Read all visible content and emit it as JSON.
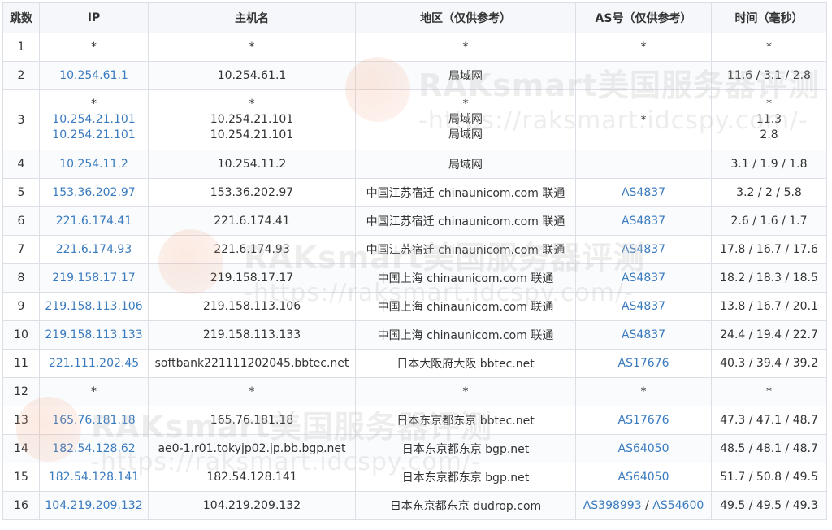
{
  "headers": {
    "hop": "跳数",
    "ip": "IP",
    "host": "主机名",
    "region": "地区（仅供参考）",
    "as": "AS号（仅供参考）",
    "time": "时间（毫秒）"
  },
  "watermark": {
    "title": "RAKsmart美国服务器评测",
    "url": "-https://raksmart.idcspy.com/-"
  },
  "colors": {
    "link": "#3a7bbf",
    "header_bg": "#f5f7fa",
    "border": "#dcdfe6"
  },
  "rows": [
    {
      "hop": "1",
      "ip": [
        "*"
      ],
      "host": [
        "*"
      ],
      "region": [
        "*"
      ],
      "as": [
        "*"
      ],
      "time": [
        "*"
      ]
    },
    {
      "hop": "2",
      "ip": [
        "10.254.61.1"
      ],
      "host": [
        "10.254.61.1"
      ],
      "region": [
        "局域网"
      ],
      "as": [],
      "time": [
        "11.6 / 3.1 / 2.8"
      ]
    },
    {
      "hop": "3",
      "ip": [
        "*",
        "10.254.21.101",
        "10.254.21.101"
      ],
      "host": [
        "*",
        "10.254.21.101",
        "10.254.21.101"
      ],
      "region": [
        "*",
        "局域网",
        "局域网"
      ],
      "as": [
        "*"
      ],
      "time": [
        "*",
        "11.3",
        "2.8"
      ]
    },
    {
      "hop": "4",
      "ip": [
        "10.254.11.2"
      ],
      "host": [
        "10.254.11.2"
      ],
      "region": [
        "局域网"
      ],
      "as": [],
      "time": [
        "3.1 / 1.9 / 1.8"
      ]
    },
    {
      "hop": "5",
      "ip": [
        "153.36.202.97"
      ],
      "host": [
        "153.36.202.97"
      ],
      "region": [
        "中国江苏宿迁 chinaunicom.com 联通"
      ],
      "as": [
        "AS4837"
      ],
      "time": [
        "3.2 / 2 / 5.8"
      ]
    },
    {
      "hop": "6",
      "ip": [
        "221.6.174.41"
      ],
      "host": [
        "221.6.174.41"
      ],
      "region": [
        "中国江苏宿迁 chinaunicom.com 联通"
      ],
      "as": [
        "AS4837"
      ],
      "time": [
        "2.6 / 1.6 / 1.7"
      ]
    },
    {
      "hop": "7",
      "ip": [
        "221.6.174.93"
      ],
      "host": [
        "221.6.174.93"
      ],
      "region": [
        "中国江苏宿迁 chinaunicom.com 联通"
      ],
      "as": [
        "AS4837"
      ],
      "time": [
        "17.8 / 16.7 / 17.6"
      ]
    },
    {
      "hop": "8",
      "ip": [
        "219.158.17.17"
      ],
      "host": [
        "219.158.17.17"
      ],
      "region": [
        "中国上海 chinaunicom.com 联通"
      ],
      "as": [
        "AS4837"
      ],
      "time": [
        "18.2 / 18.3 / 18.5"
      ]
    },
    {
      "hop": "9",
      "ip": [
        "219.158.113.106"
      ],
      "host": [
        "219.158.113.106"
      ],
      "region": [
        "中国上海 chinaunicom.com 联通"
      ],
      "as": [
        "AS4837"
      ],
      "time": [
        "13.8 / 16.7 / 20.1"
      ]
    },
    {
      "hop": "10",
      "ip": [
        "219.158.113.133"
      ],
      "host": [
        "219.158.113.133"
      ],
      "region": [
        "中国上海 chinaunicom.com 联通"
      ],
      "as": [
        "AS4837"
      ],
      "time": [
        "24.4 / 19.4 / 22.7"
      ]
    },
    {
      "hop": "11",
      "ip": [
        "221.111.202.45"
      ],
      "host": [
        "softbank221111202045.bbtec.net"
      ],
      "region": [
        "日本大阪府大阪 bbtec.net"
      ],
      "as": [
        "AS17676"
      ],
      "time": [
        "40.3 / 39.4 / 39.2"
      ]
    },
    {
      "hop": "12",
      "ip": [
        "*"
      ],
      "host": [
        "*"
      ],
      "region": [
        "*"
      ],
      "as": [
        "*"
      ],
      "time": [
        "*"
      ]
    },
    {
      "hop": "13",
      "ip": [
        "165.76.181.18"
      ],
      "host": [
        "165.76.181.18"
      ],
      "region": [
        "日本东京都东京 bbtec.net"
      ],
      "as": [
        "AS17676"
      ],
      "time": [
        "47.3 / 47.1 / 48.7"
      ]
    },
    {
      "hop": "14",
      "ip": [
        "182.54.128.62"
      ],
      "host": [
        "ae0-1.r01.tokyjp02.jp.bb.bgp.net"
      ],
      "region": [
        "日本东京都东京 bgp.net"
      ],
      "as": [
        "AS64050"
      ],
      "time": [
        "48.5 / 48.1 / 48.7"
      ]
    },
    {
      "hop": "15",
      "ip": [
        "182.54.128.141"
      ],
      "host": [
        "182.54.128.141"
      ],
      "region": [
        "日本东京都东京 bgp.net"
      ],
      "as": [
        "AS64050"
      ],
      "time": [
        "51.7 / 50.8 / 49.5"
      ]
    },
    {
      "hop": "16",
      "ip": [
        "104.219.209.132"
      ],
      "host": [
        "104.219.209.132"
      ],
      "region": [
        "日本东京都东京 dudrop.com"
      ],
      "as": [
        "AS398993",
        "AS54600"
      ],
      "time": [
        "49.5 / 49.5 / 49.3"
      ]
    }
  ]
}
